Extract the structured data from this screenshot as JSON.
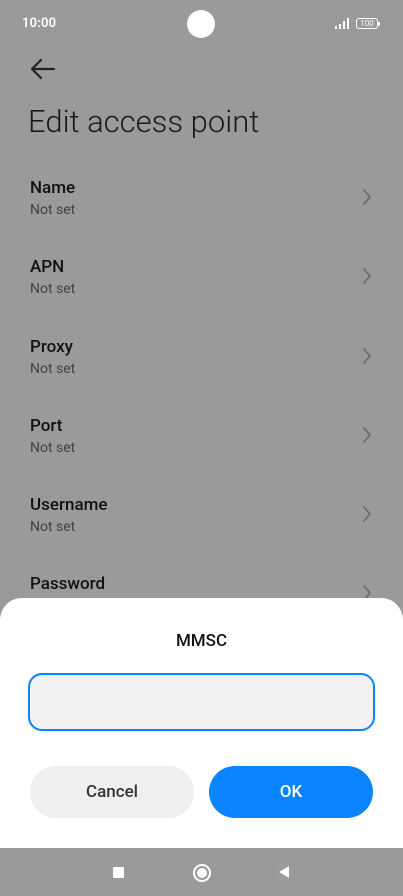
{
  "status": {
    "time": "10:00",
    "battery": "100"
  },
  "page": {
    "title": "Edit access point"
  },
  "settings": [
    {
      "label": "Name",
      "value": "Not set"
    },
    {
      "label": "APN",
      "value": "Not set"
    },
    {
      "label": "Proxy",
      "value": "Not set"
    },
    {
      "label": "Port",
      "value": "Not set"
    },
    {
      "label": "Username",
      "value": "Not set"
    },
    {
      "label": "Password",
      "value": ""
    }
  ],
  "dialog": {
    "title": "MMSC",
    "input_value": "",
    "cancel_label": "Cancel",
    "ok_label": "OK"
  },
  "icons": {
    "back": "arrow-left-icon",
    "chevron": "chevron-right-icon",
    "nav_recent": "square-icon",
    "nav_home": "circle-icon",
    "nav_back": "triangle-left-icon"
  },
  "colors": {
    "accent": "#0A84FF",
    "overlay": "#9A9A9A"
  }
}
